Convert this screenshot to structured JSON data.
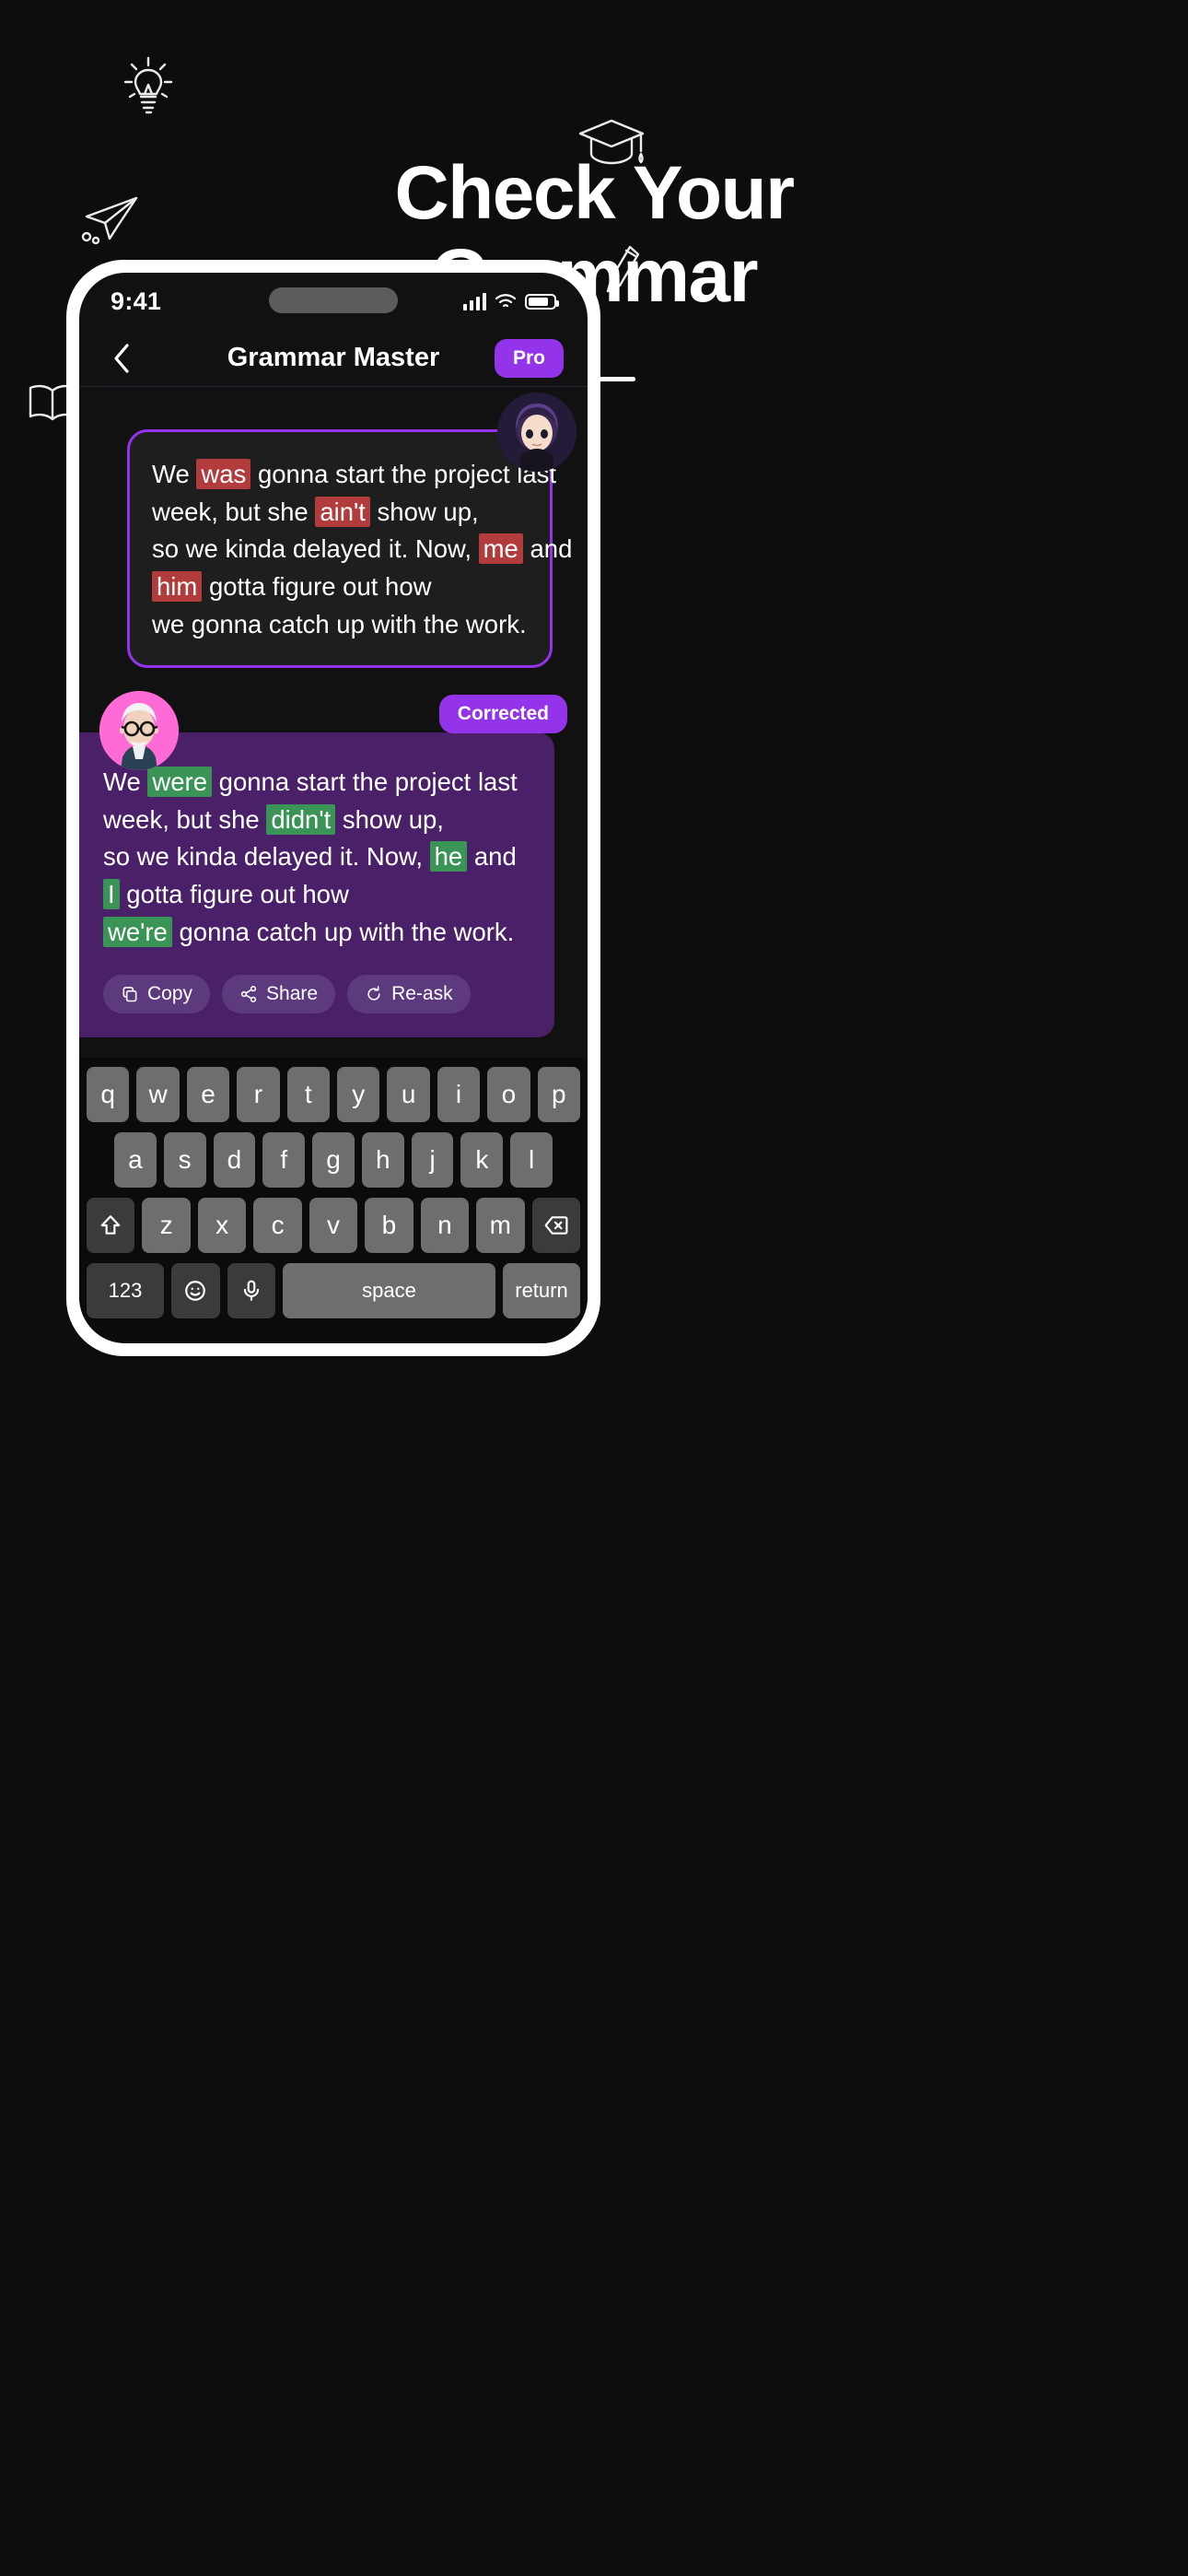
{
  "promo": {
    "headline_line1": "Check Your",
    "headline_line2": "Grammar",
    "doodles": [
      "lightbulb-icon",
      "graduation-cap-icon",
      "paper-plane-icon",
      "pencil-icon",
      "open-book-icon"
    ]
  },
  "status_bar": {
    "time": "9:41",
    "icons": [
      "cellular-signal-icon",
      "wifi-icon",
      "battery-icon"
    ]
  },
  "nav": {
    "back_icon": "chevron-left-icon",
    "title": "Grammar Master",
    "pro_label": "Pro"
  },
  "chat": {
    "user_message": {
      "avatar": "anime-girl-avatar",
      "lines": [
        [
          {
            "t": "We ",
            "h": null
          },
          {
            "t": "was",
            "h": "bad"
          },
          {
            "t": " gonna start the project last",
            "h": null
          }
        ],
        [
          {
            "t": "week, but she ",
            "h": null
          },
          {
            "t": "ain't",
            "h": "bad"
          },
          {
            "t": " show up,",
            "h": null
          }
        ],
        [
          {
            "t": "so we kinda delayed it. Now, ",
            "h": null
          },
          {
            "t": "me",
            "h": "bad"
          },
          {
            "t": " and",
            "h": null
          }
        ],
        [
          {
            "t": "",
            "h": null
          },
          {
            "t": "him",
            "h": "bad"
          },
          {
            "t": " gotta figure out how",
            "h": null
          }
        ],
        [
          {
            "t": "we gonna catch up with the work.",
            "h": null
          }
        ]
      ]
    },
    "ai_message": {
      "avatar": "professor-avatar",
      "badge": "Corrected",
      "lines": [
        [
          {
            "t": "We ",
            "h": null
          },
          {
            "t": "were",
            "h": "good"
          },
          {
            "t": " gonna start the project last",
            "h": null
          }
        ],
        [
          {
            "t": "week, but she ",
            "h": null
          },
          {
            "t": "didn't",
            "h": "good"
          },
          {
            "t": " show up,",
            "h": null
          }
        ],
        [
          {
            "t": "so we kinda delayed it. Now, ",
            "h": null
          },
          {
            "t": "he",
            "h": "good"
          },
          {
            "t": " and",
            "h": null
          }
        ],
        [
          {
            "t": "",
            "h": null
          },
          {
            "t": "I",
            "h": "good"
          },
          {
            "t": " gotta figure out how",
            "h": null
          }
        ],
        [
          {
            "t": "",
            "h": null
          },
          {
            "t": "we're",
            "h": "good"
          },
          {
            "t": " gonna catch up with the work.",
            "h": null
          }
        ]
      ],
      "actions": [
        {
          "label": "Copy",
          "icon": "copy-icon"
        },
        {
          "label": "Share",
          "icon": "share-nodes-icon"
        },
        {
          "label": "Re-ask",
          "icon": "refresh-icon"
        }
      ]
    }
  },
  "keyboard": {
    "row1": [
      "q",
      "w",
      "e",
      "r",
      "t",
      "y",
      "u",
      "i",
      "o",
      "p"
    ],
    "row2": [
      "a",
      "s",
      "d",
      "f",
      "g",
      "h",
      "j",
      "k",
      "l"
    ],
    "row3_shift_icon": "shift-icon",
    "row3": [
      "z",
      "x",
      "c",
      "v",
      "b",
      "n",
      "m"
    ],
    "row3_backspace_icon": "backspace-icon",
    "row4_numbers": "123",
    "row4_emoji_icon": "emoji-icon",
    "row4_mic_icon": "microphone-icon",
    "row4_space": "space",
    "row4_return": "return"
  },
  "colors": {
    "accent_purple": "#9333ea",
    "bubble_purple": "#4a2068",
    "error_red": "#b23b3b",
    "correct_green": "#3a9456",
    "avatar_pink": "#ff6bd6",
    "background": "#0d0d0d"
  }
}
